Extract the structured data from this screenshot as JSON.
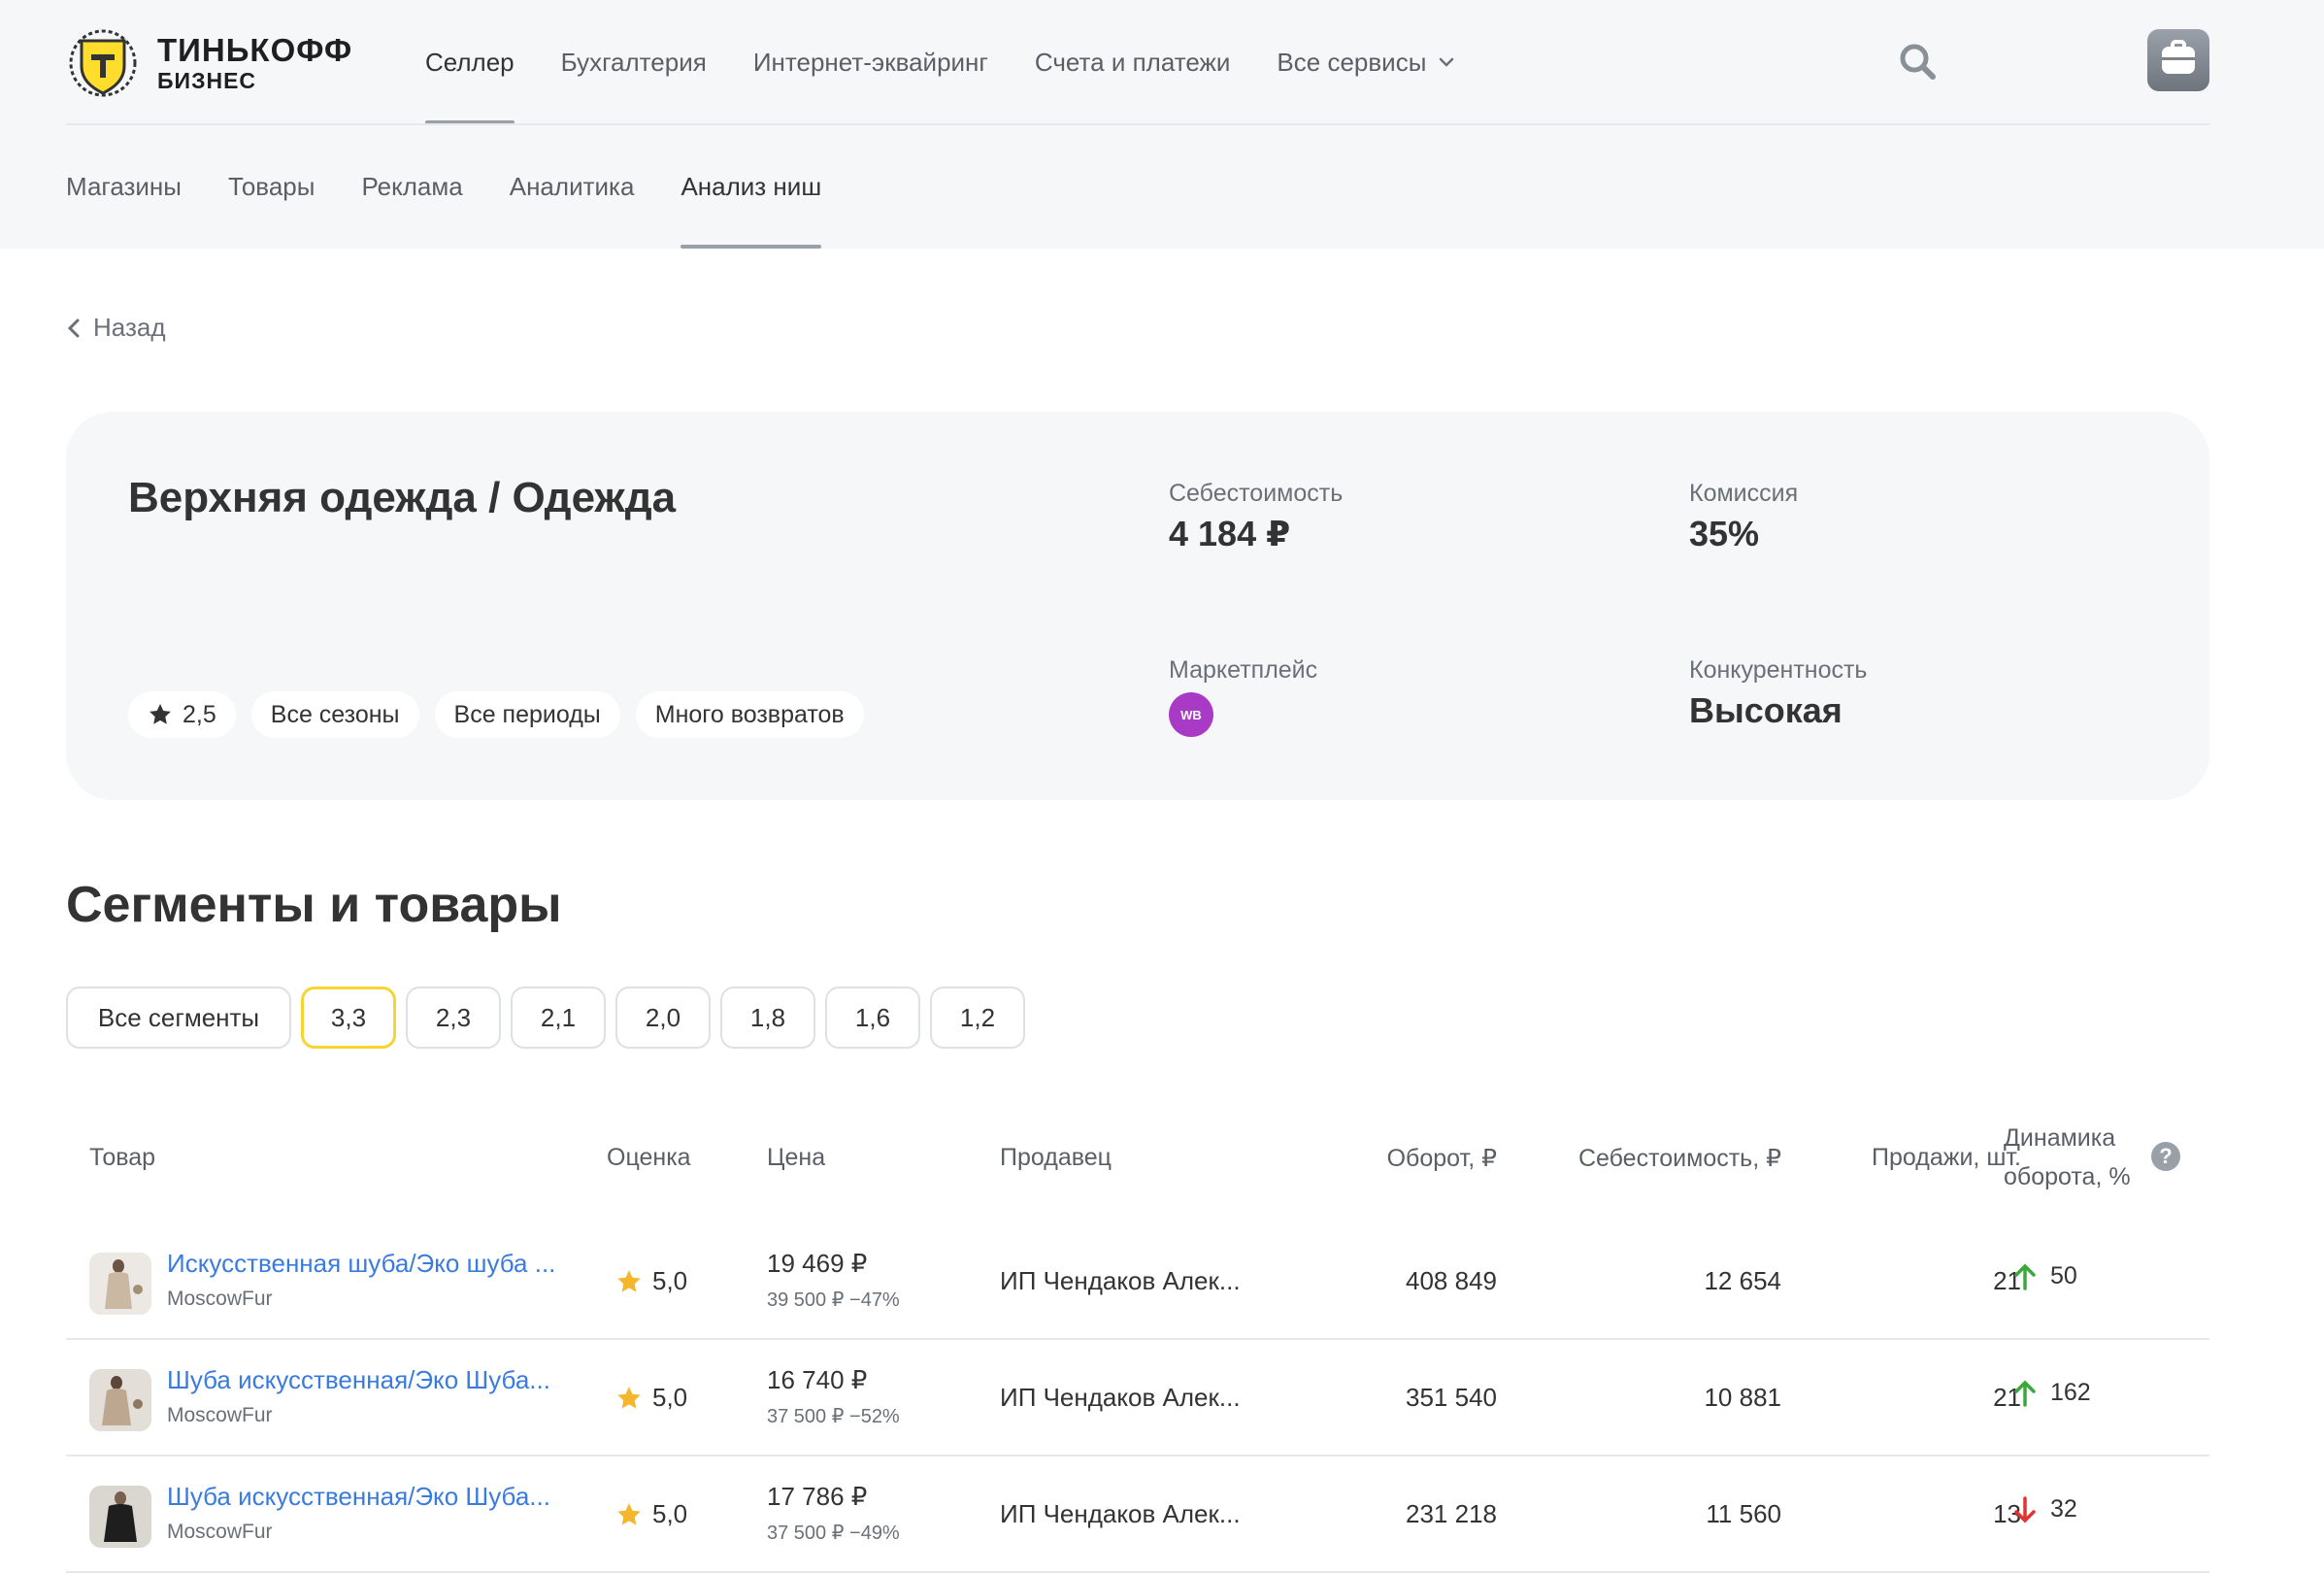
{
  "brand": {
    "line1": "ТИНЬКОФФ",
    "line2": "БИЗНЕС"
  },
  "main_nav": [
    {
      "label": "Селлер",
      "active": true
    },
    {
      "label": "Бухгалтерия",
      "active": false
    },
    {
      "label": "Интернет-эквайринг",
      "active": false
    },
    {
      "label": "Счета и платежи",
      "active": false
    },
    {
      "label": "Все сервисы",
      "active": false
    }
  ],
  "sub_nav": [
    {
      "label": "Магазины",
      "active": false
    },
    {
      "label": "Товары",
      "active": false
    },
    {
      "label": "Реклама",
      "active": false
    },
    {
      "label": "Аналитика",
      "active": false
    },
    {
      "label": "Анализ ниш",
      "active": true
    }
  ],
  "back_label": "Назад",
  "niche": {
    "title": "Верхняя одежда / Одежда",
    "tags": [
      "2,5",
      "Все сезоны",
      "Все периоды",
      "Много возвратов"
    ],
    "cost_label": "Себестоимость",
    "cost_value": "4 184 ₽",
    "commission_label": "Комиссия",
    "commission_value": "35%",
    "marketplace_label": "Маркетплейс",
    "marketplace_badge": "WB",
    "competition_label": "Конкурентность",
    "competition_value": "Высокая"
  },
  "section_title": "Сегменты и товары",
  "segments": [
    {
      "label": "Все сегменты",
      "selected": false
    },
    {
      "label": "3,3",
      "selected": true
    },
    {
      "label": "2,3",
      "selected": false
    },
    {
      "label": "2,1",
      "selected": false
    },
    {
      "label": "2,0",
      "selected": false
    },
    {
      "label": "1,8",
      "selected": false
    },
    {
      "label": "1,6",
      "selected": false
    },
    {
      "label": "1,2",
      "selected": false
    }
  ],
  "table": {
    "headers": {
      "product": "Товар",
      "rating": "Оценка",
      "price": "Цена",
      "seller": "Продавец",
      "turnover": "Оборот, ₽",
      "cost": "Себестоимость, ₽",
      "sales": "Продажи, шт.",
      "dynamics_l1": "Динамика",
      "dynamics_l2": "оборота, %"
    },
    "rows": [
      {
        "name": "Искусственная шуба/Эко шуба ...",
        "brand": "MoscowFur",
        "rating": "5,0",
        "price": "19 469 ₽",
        "old_price": "39 500 ₽  −47%",
        "seller": "ИП Чендаков Алек...",
        "turnover": "408 849",
        "cost": "12 654",
        "sales": "21",
        "dynamics": "50",
        "trend": "up"
      },
      {
        "name": "Шуба искусственная/Эко Шуба...",
        "brand": "MoscowFur",
        "rating": "5,0",
        "price": "16 740 ₽",
        "old_price": "37 500 ₽  −52%",
        "seller": "ИП Чендаков Алек...",
        "turnover": "351 540",
        "cost": "10 881",
        "sales": "21",
        "dynamics": "162",
        "trend": "up"
      },
      {
        "name": "Шуба искусственная/Эко Шуба...",
        "brand": "MoscowFur",
        "rating": "5,0",
        "price": "17 786 ₽",
        "old_price": "37 500 ₽  −49%",
        "seller": "ИП Чендаков Алек...",
        "turnover": "231 218",
        "cost": "11 560",
        "sales": "13",
        "dynamics": "32",
        "trend": "down"
      }
    ]
  },
  "colors": {
    "accent_yellow": "#f5d531",
    "link_blue": "#3a7be0",
    "up_green": "#3aa83a",
    "down_red": "#e2332f",
    "star_yellow": "#f3b62c",
    "wb_purple": "#a93ac5"
  }
}
